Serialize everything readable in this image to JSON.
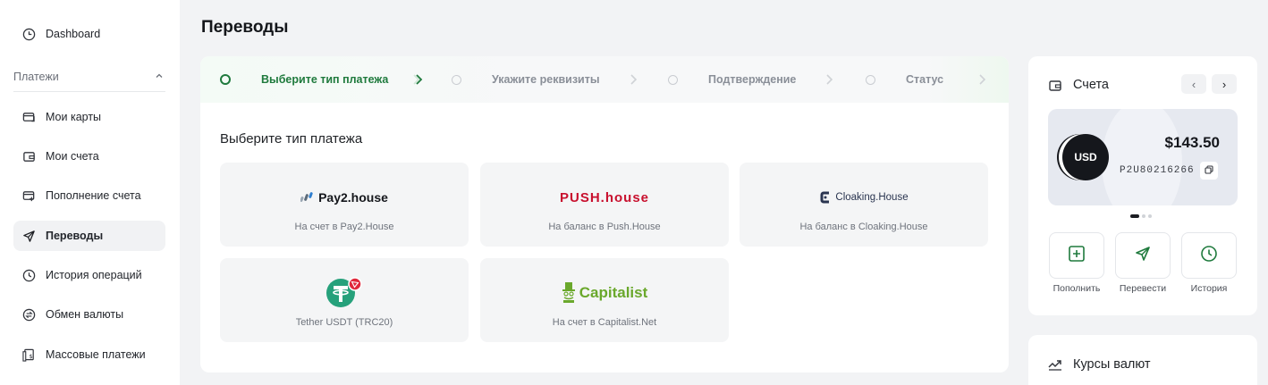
{
  "sidebar": {
    "dashboard": "Dashboard",
    "group_label": "Платежи",
    "items": [
      {
        "label": "Мои карты",
        "icon": "card-icon"
      },
      {
        "label": "Мои счета",
        "icon": "wallet-icon"
      },
      {
        "label": "Пополнение счета",
        "icon": "topup-icon"
      },
      {
        "label": "Переводы",
        "icon": "send-icon",
        "active": true
      },
      {
        "label": "История операций",
        "icon": "history-icon"
      },
      {
        "label": "Обмен валюты",
        "icon": "exchange-icon"
      },
      {
        "label": "Массовые платежи",
        "icon": "mass-payments-icon"
      }
    ]
  },
  "header": {
    "title": "Переводы"
  },
  "stepper": {
    "steps": [
      "Выберите тип платежа",
      "Укажите реквизиты",
      "Подтверждение",
      "Статус"
    ],
    "active_index": 0,
    "accent": "#1f7a3d"
  },
  "payment_types": {
    "title": "Выберите тип платежа",
    "tiles": [
      {
        "logo_text": "Pay2.house",
        "caption": "На счет в Pay2.House"
      },
      {
        "logo_text": "PUSH.house",
        "caption": "На баланс в Push.House"
      },
      {
        "logo_text": "Cloaking.House",
        "caption": "На баланс в Cloaking.House"
      },
      {
        "logo_text": "",
        "caption": "Tether USDT (TRC20)"
      },
      {
        "logo_text": "Capitalist",
        "caption": "На счет в Capitalist.Net"
      }
    ]
  },
  "accounts": {
    "title": "Счета",
    "prev": "‹",
    "next": "›",
    "card": {
      "currency": "USD",
      "balance": "$143.50",
      "number": "P2U80216266"
    },
    "carousel_position": "1 of 3",
    "actions": [
      {
        "label": "Пополнить",
        "icon": "plus-square-icon"
      },
      {
        "label": "Перевести",
        "icon": "send-icon"
      },
      {
        "label": "История",
        "icon": "clock-icon"
      }
    ],
    "accent": "#1f7a3d"
  },
  "rates": {
    "title": "Курсы валют"
  }
}
